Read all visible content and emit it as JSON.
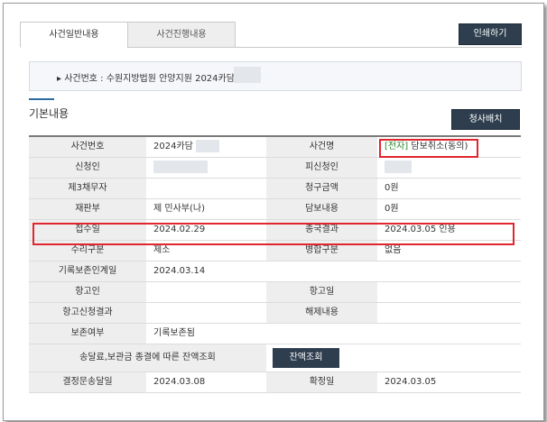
{
  "tabs": [
    {
      "label": "사건일반내용",
      "active": true
    },
    {
      "label": "사건진행내용",
      "active": false
    }
  ],
  "print_button": "인쇄하기",
  "case_info": "사건번호 : 수원지방법원 안양지원 2024카담",
  "section_title": "기본내용",
  "claim_button": "청사배치",
  "rows": [
    {
      "l1": "사건번호",
      "v1": "2024카담",
      "l2": "사건명",
      "v2_tag": "[전자]",
      "v2": " 담보취소(동의)"
    },
    {
      "l1": "신청인",
      "v1": "",
      "l2": "피신청인",
      "v2": ""
    },
    {
      "l1": "제3채무자",
      "v1": "",
      "l2": "청구금액",
      "v2": "0원"
    },
    {
      "l1": "재판부",
      "v1": "제  민사부(나)",
      "l2": "담보내용",
      "v2": "0원"
    },
    {
      "l1": "접수일",
      "v1": "2024.02.29",
      "l2": "종국결과",
      "v2": "2024.03.05 인용"
    },
    {
      "l1": "수리구분",
      "v1": "제소",
      "l2": "병합구분",
      "v2": "없음"
    },
    {
      "l1": "기록보존인계일",
      "v1": "2024.03.14",
      "l2": "",
      "v2": ""
    },
    {
      "l1": "항고인",
      "v1": "",
      "l2": "항고일",
      "v2": ""
    },
    {
      "l1": "항고신청결과",
      "v1": "",
      "l2": "해제내용",
      "v2": ""
    },
    {
      "l1": "보존여부",
      "v1": "기록보존됨",
      "l2": "",
      "v2": ""
    },
    {
      "wide_label": "송달료,보관금 종결에 따른 잔액조회",
      "button": "잔액조회"
    },
    {
      "l1": "결정문송달일",
      "v1": "2024.03.08",
      "l2": "확정일",
      "v2": "2024.03.05"
    }
  ],
  "colors": {
    "accent": "#2e3e4e",
    "highlight": "#e0262e",
    "tag_green": "#2a8a2a"
  }
}
